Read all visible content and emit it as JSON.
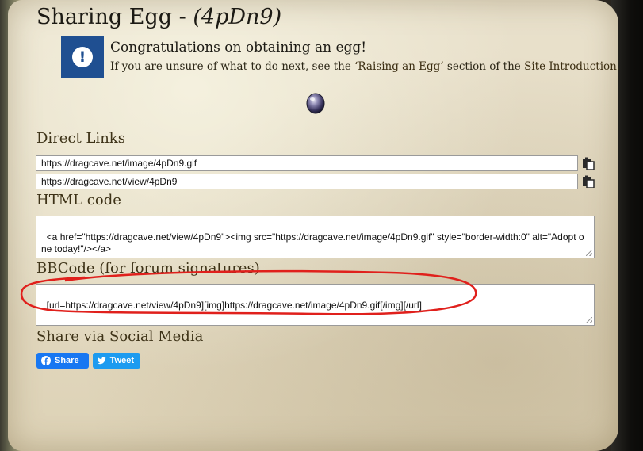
{
  "page": {
    "title_prefix": "Sharing Egg - ",
    "egg_code": "(4pDn9)"
  },
  "notice": {
    "icon": "exclamation-icon",
    "heading": "Congratulations on obtaining an egg!",
    "text_before": "If you are unsure of what to do next, see the ",
    "link1": "‘Raising an Egg’",
    "text_middle": " section of the ",
    "link2": "Site Introduction",
    "text_after": "."
  },
  "egg_image": "egg-icon",
  "sections": {
    "direct_links": {
      "heading": "Direct Links",
      "image_url": "https://dragcave.net/image/4pDn9.gif",
      "view_url": "https://dragcave.net/view/4pDn9",
      "copy_icon": "clipboard-icon"
    },
    "html_code": {
      "heading": "HTML code",
      "value": "<a href=\"https://dragcave.net/view/4pDn9\"><img src=\"https://dragcave.net/image/4pDn9.gif\" style=\"border-width:0\" alt=\"Adopt one today!\"/></a>"
    },
    "bbcode": {
      "heading": "BBCode (for forum signatures)",
      "value": "[url=https://dragcave.net/view/4pDn9][img]https://dragcave.net/image/4pDn9.gif[/img][/url]"
    },
    "social": {
      "heading": "Share via Social Media",
      "facebook_label": "Share",
      "twitter_label": "Tweet"
    }
  },
  "colors": {
    "notice_blue": "#1f4f91",
    "facebook": "#1877f2",
    "twitter": "#1d9bf0",
    "highlight_red": "#e0201c"
  }
}
